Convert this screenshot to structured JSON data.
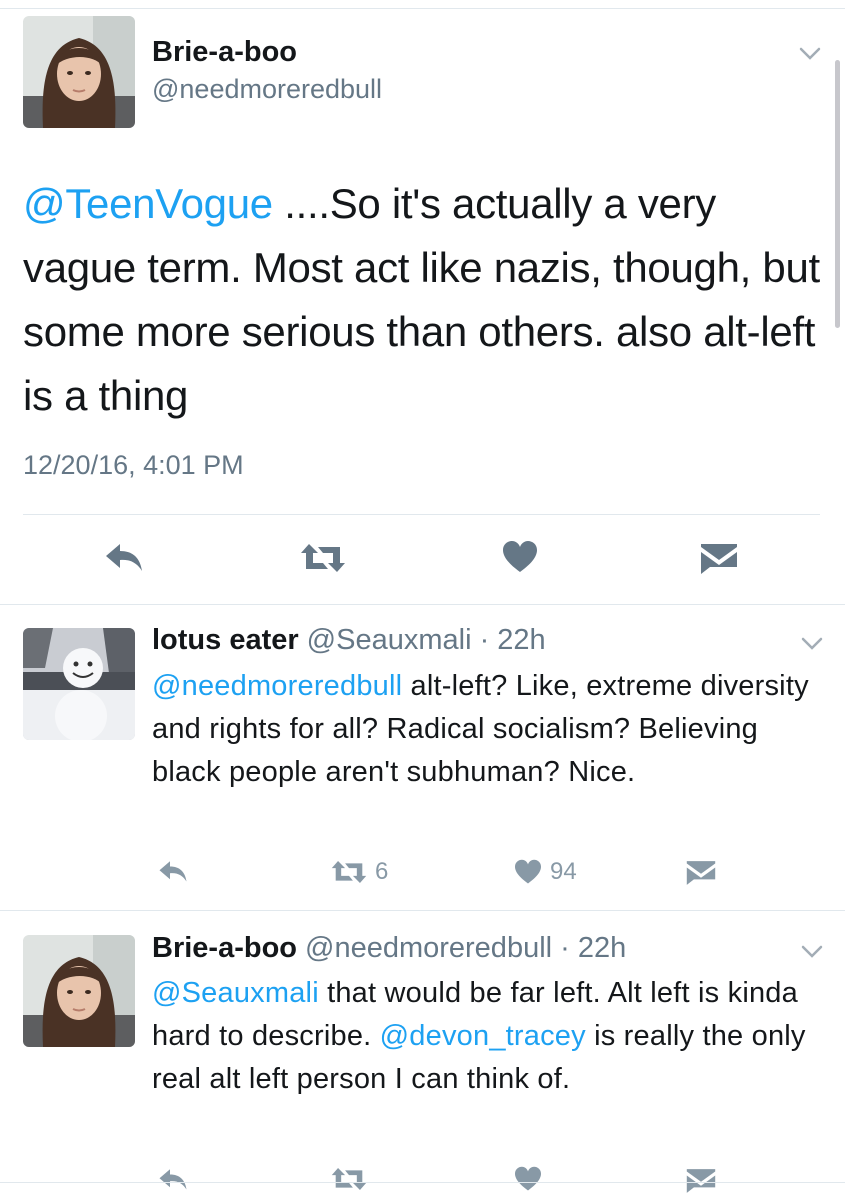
{
  "main_tweet": {
    "display_name": "Brie-a-boo",
    "handle": "@needmoreredbull",
    "text_mention": "@TeenVogue",
    "text_body": " ....So it's actually a very vague term. Most act like nazis, though, but some more serious than others. also alt-left is a thing",
    "timestamp": "12/20/16, 4:01 PM",
    "actions": [
      "reply-icon",
      "retweet-icon",
      "like-icon",
      "direct-message-icon"
    ]
  },
  "replies": [
    {
      "display_name": "lotus eater",
      "meta": "@Seauxmali · 22h",
      "segments": [
        {
          "text": "@needmoreredbull",
          "mention": true
        },
        {
          "text": " alt-left? Like, extreme diversity and rights for all? Radical socialism? Believing black people aren't subhuman? Nice.",
          "mention": false
        }
      ],
      "retweets": "6",
      "likes": "94"
    },
    {
      "display_name": "Brie-a-boo",
      "meta": "@needmoreredbull · 22h",
      "segments": [
        {
          "text": "@Seauxmali",
          "mention": true
        },
        {
          "text": " that would be far left. Alt left is kinda hard to describe. ",
          "mention": false
        },
        {
          "text": "@devon_tracey",
          "mention": true
        },
        {
          "text": " is really the only real alt left person I can think of.",
          "mention": false
        }
      ],
      "retweets": "",
      "likes": ""
    }
  ],
  "colors": {
    "link": "#1da1f2",
    "icon_main": "#657786",
    "icon_reply": "#8899a6",
    "divider": "#e1e8ed"
  }
}
